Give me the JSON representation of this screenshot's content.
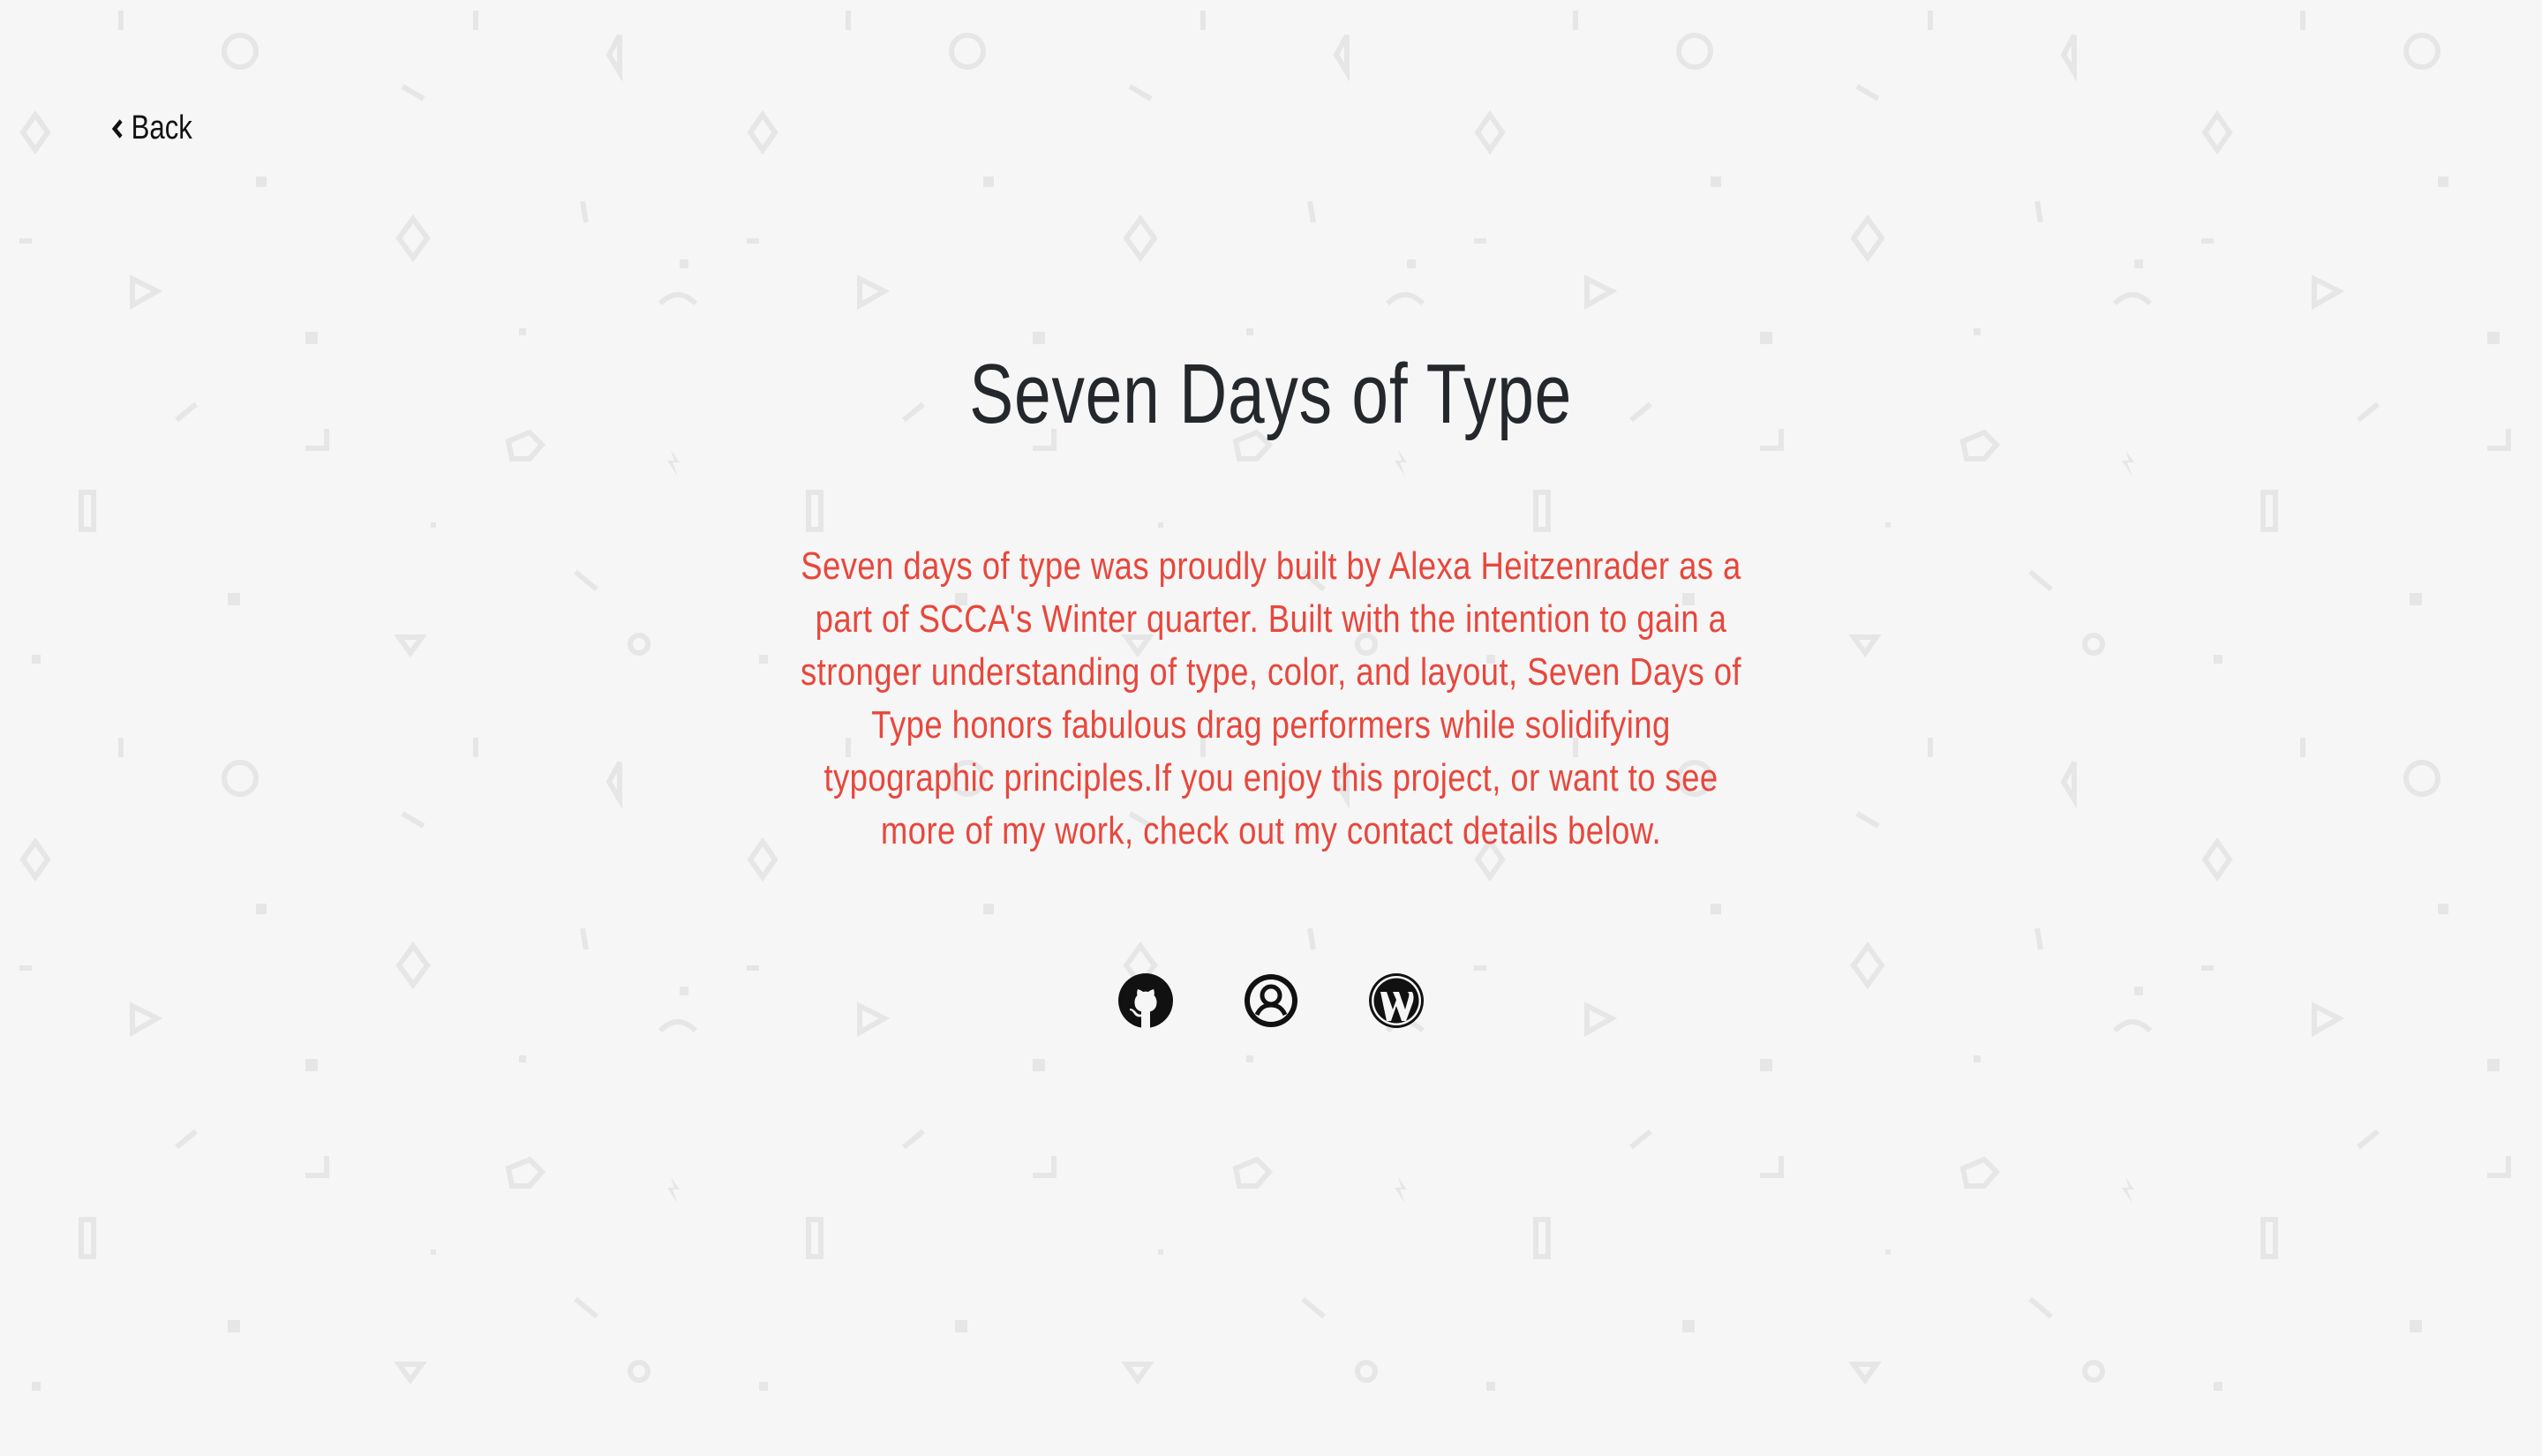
{
  "nav": {
    "back_label": "Back"
  },
  "page": {
    "title": "Seven Days of Type",
    "description": "Seven days of type was proudly built by Alexa Heitzenrader as a part of SCCA's Winter quarter. Built with the intention to gain a stronger understanding of type, color, and layout, Seven Days of Type honors fabulous drag performers while solidifying typographic principles.If you enjoy this project, or want to see more of my work, check out my contact details below."
  },
  "socials": [
    {
      "icon": "github-icon"
    },
    {
      "icon": "user-circle-icon"
    },
    {
      "icon": "wordpress-icon"
    }
  ],
  "colors": {
    "background": "#f6f6f6",
    "title": "#24272b",
    "accent": "#e8473c",
    "pattern": "#e9e9e9"
  }
}
